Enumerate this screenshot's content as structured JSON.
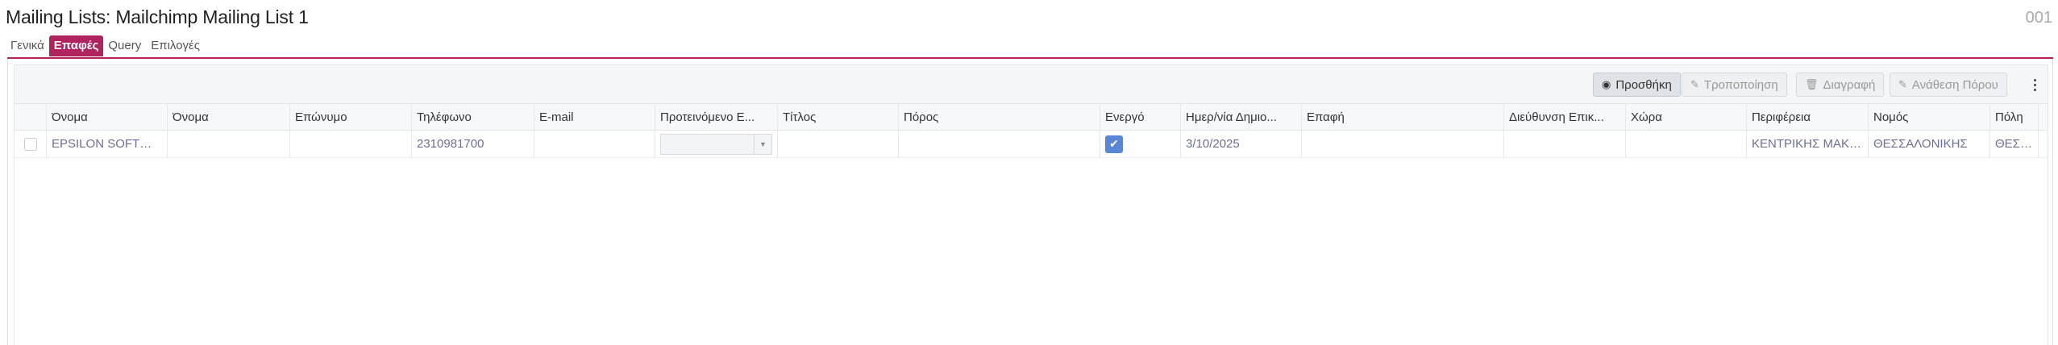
{
  "header": {
    "title": "Mailing Lists: Mailchimp Mailing List 1",
    "record_id": "001"
  },
  "tabs": [
    {
      "label": "Γενικά",
      "active": false
    },
    {
      "label": "Επαφές",
      "active": true
    },
    {
      "label": "Query",
      "active": false
    },
    {
      "label": "Επιλογές",
      "active": false
    }
  ],
  "toolbar": {
    "add_label": "Προσθήκη",
    "edit_label": "Τροποποίηση",
    "delete_label": "Διαγραφή",
    "assign_label": "Ανάθεση Πόρου"
  },
  "grid": {
    "columns": [
      "Όνομα",
      "Όνομα",
      "Επώνυμο",
      "Τηλέφωνο",
      "E-mail",
      "Προτεινόμενο Ε...",
      "Τίτλος",
      "Πόρος",
      "Ενεργό",
      "Ημερ/νία Δημιο...",
      "Επαφή",
      "Διεύθυνση Επικ...",
      "Χώρα",
      "Περιφέρεια",
      "Νομός",
      "Πόλη"
    ],
    "rows": [
      {
        "name": "EPSILON SOFTWARE...",
        "first_name": "",
        "last_name": "",
        "phone": "2310981700",
        "email": "",
        "suggested": "",
        "title": "",
        "resource": "",
        "active": true,
        "created": "3/10/2025",
        "contact": "",
        "address": "",
        "country": "",
        "region": "ΚΕΝΤΡΙΚΗΣ ΜΑΚΕΔ...",
        "prefecture": "ΘΕΣΣΑΛΟΝΙΚΗΣ",
        "city": "ΘΕΣΣΑΛΟ"
      }
    ]
  },
  "colors": {
    "accent": "#b0235f",
    "check": "#5a86d6",
    "link_text": "#6b6f9a"
  }
}
